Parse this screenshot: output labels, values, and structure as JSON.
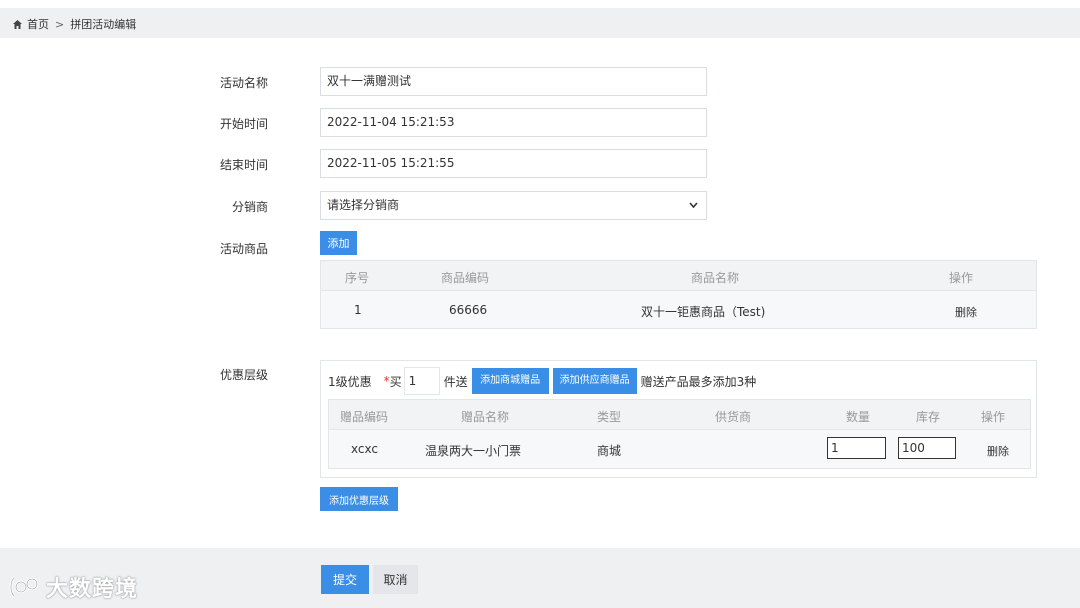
{
  "breadcrumb": {
    "home": "首页",
    "separator": ">",
    "current": "拼团活动编辑"
  },
  "form": {
    "name_label": "活动名称",
    "name_value": "双十一满赠测试",
    "start_label": "开始时间",
    "start_value": "2022-11-04 15:21:53",
    "end_label": "结束时间",
    "end_value": "2022-11-05 15:21:55",
    "distributor_label": "分销商",
    "distributor_value": "请选择分销商",
    "products_label": "活动商品",
    "add_label": "添加"
  },
  "product_table": {
    "headers": [
      "序号",
      "商品编码",
      "商品名称",
      "操作"
    ],
    "rows": [
      {
        "index": "1",
        "code": "66666",
        "name": "双十一钜惠商品（Test)",
        "action": "删除"
      }
    ]
  },
  "tier": {
    "section_label": "优惠层级",
    "level_label": "1级优惠",
    "required_mark": "*",
    "buy_label": "买",
    "qty_value": "1",
    "gift_suffix": "件送",
    "add_mall_gift": "添加商城赠品",
    "add_supplier_gift": "添加供应商赠品",
    "note": "赠送产品最多添加3种",
    "gift_headers": [
      "赠品编码",
      "赠品名称",
      "类型",
      "供货商",
      "数量",
      "库存",
      "操作"
    ],
    "gift_rows": [
      {
        "code": "xcxc",
        "name": "温泉两大一小门票",
        "type": "商城",
        "supplier": "",
        "qty": "1",
        "stock": "100",
        "action": "删除"
      }
    ],
    "add_tier": "添加优惠层级"
  },
  "footer": {
    "submit": "提交",
    "cancel": "取消"
  },
  "watermark": {
    "text": "大数跨境"
  },
  "colors": {
    "accent": "#3a8ee6",
    "link": "#2d6bd3",
    "required": "#e53935"
  }
}
